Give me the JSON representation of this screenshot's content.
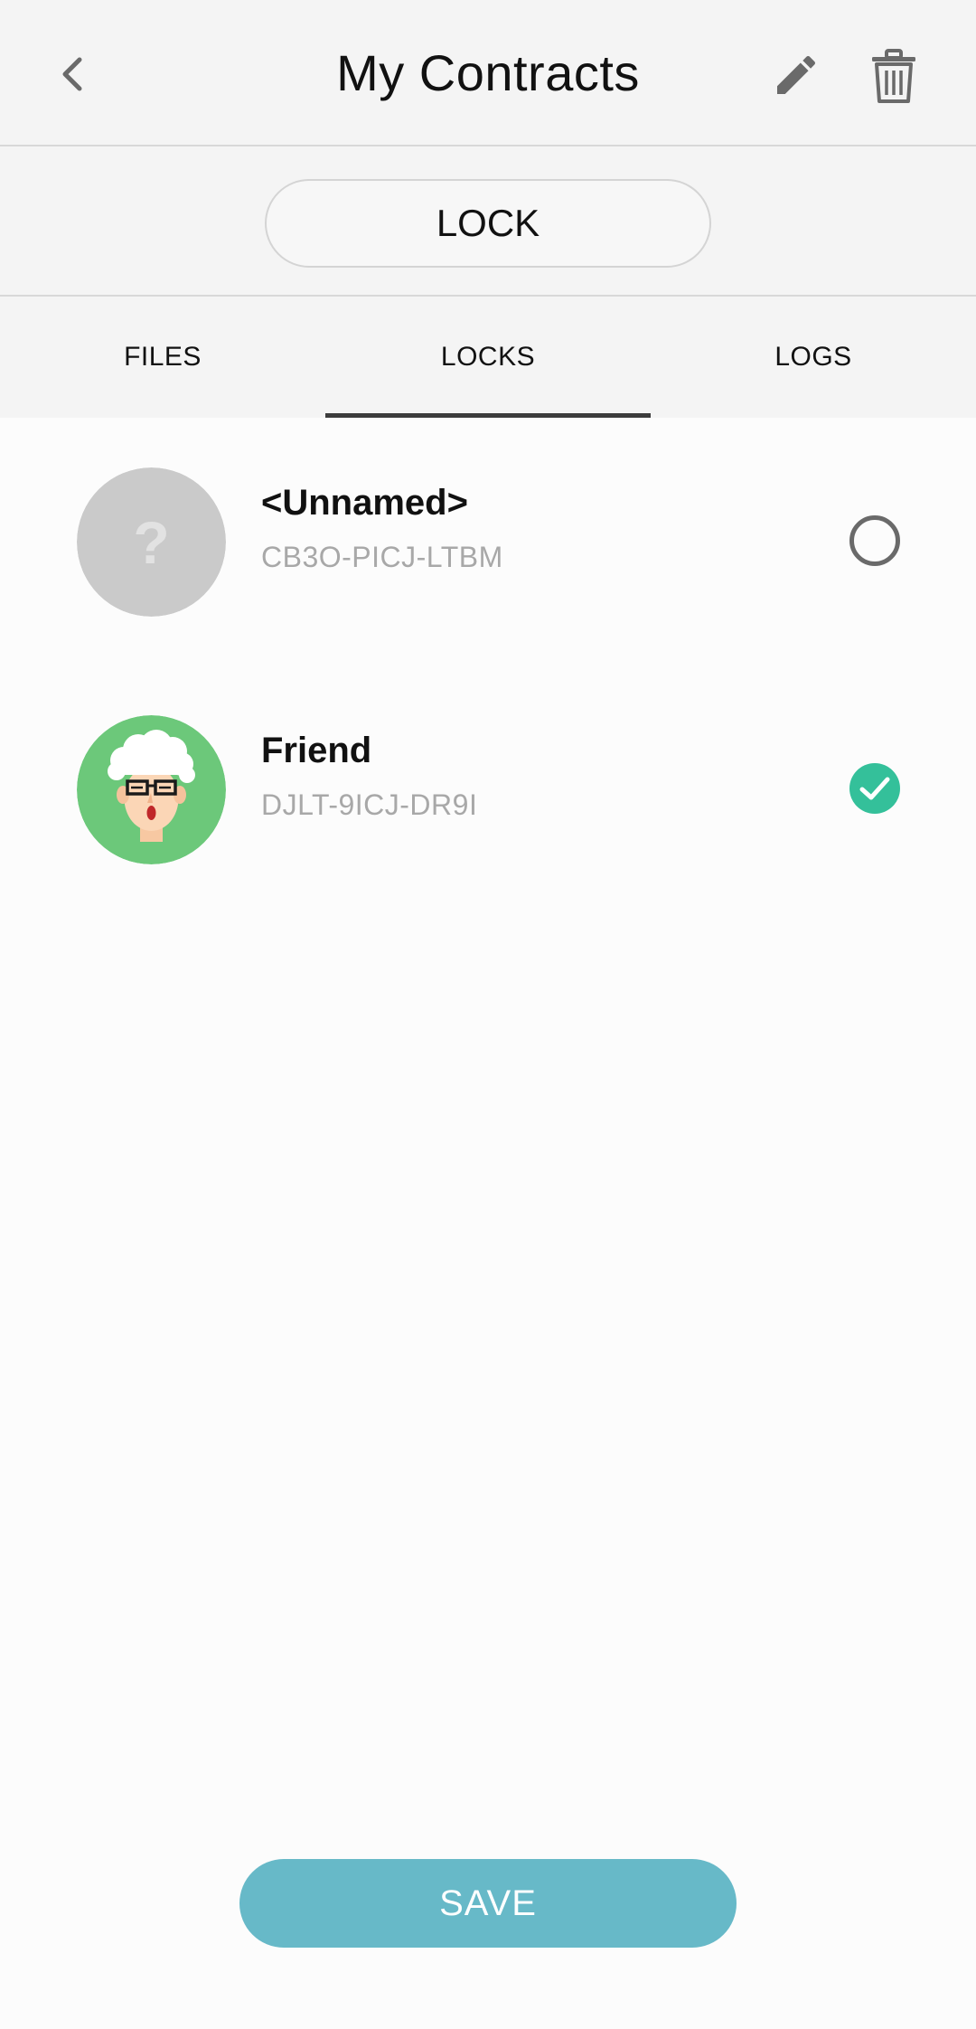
{
  "header": {
    "title": "My Contracts",
    "back_icon": "chevron-left-icon",
    "edit_icon": "pencil-icon",
    "delete_icon": "trash-icon"
  },
  "lock_bar": {
    "button_label": "LOCK"
  },
  "tabs": [
    {
      "label": "FILES",
      "active": false
    },
    {
      "label": "LOCKS",
      "active": true
    },
    {
      "label": "LOGS",
      "active": false
    }
  ],
  "locks": [
    {
      "name": "<Unnamed>",
      "code": "CB3O-PICJ-LTBM",
      "selected": false,
      "avatar": "unknown-avatar",
      "avatar_glyph": "?"
    },
    {
      "name": "Friend",
      "code": "DJLT-9ICJ-DR9I",
      "selected": true,
      "avatar": "old-man-avatar"
    }
  ],
  "footer": {
    "save_label": "SAVE"
  },
  "colors": {
    "accent_teal": "#34c09a",
    "save_button": "#67b9c8",
    "avatar_green": "#6cc87a",
    "avatar_grey": "#cacaca"
  }
}
